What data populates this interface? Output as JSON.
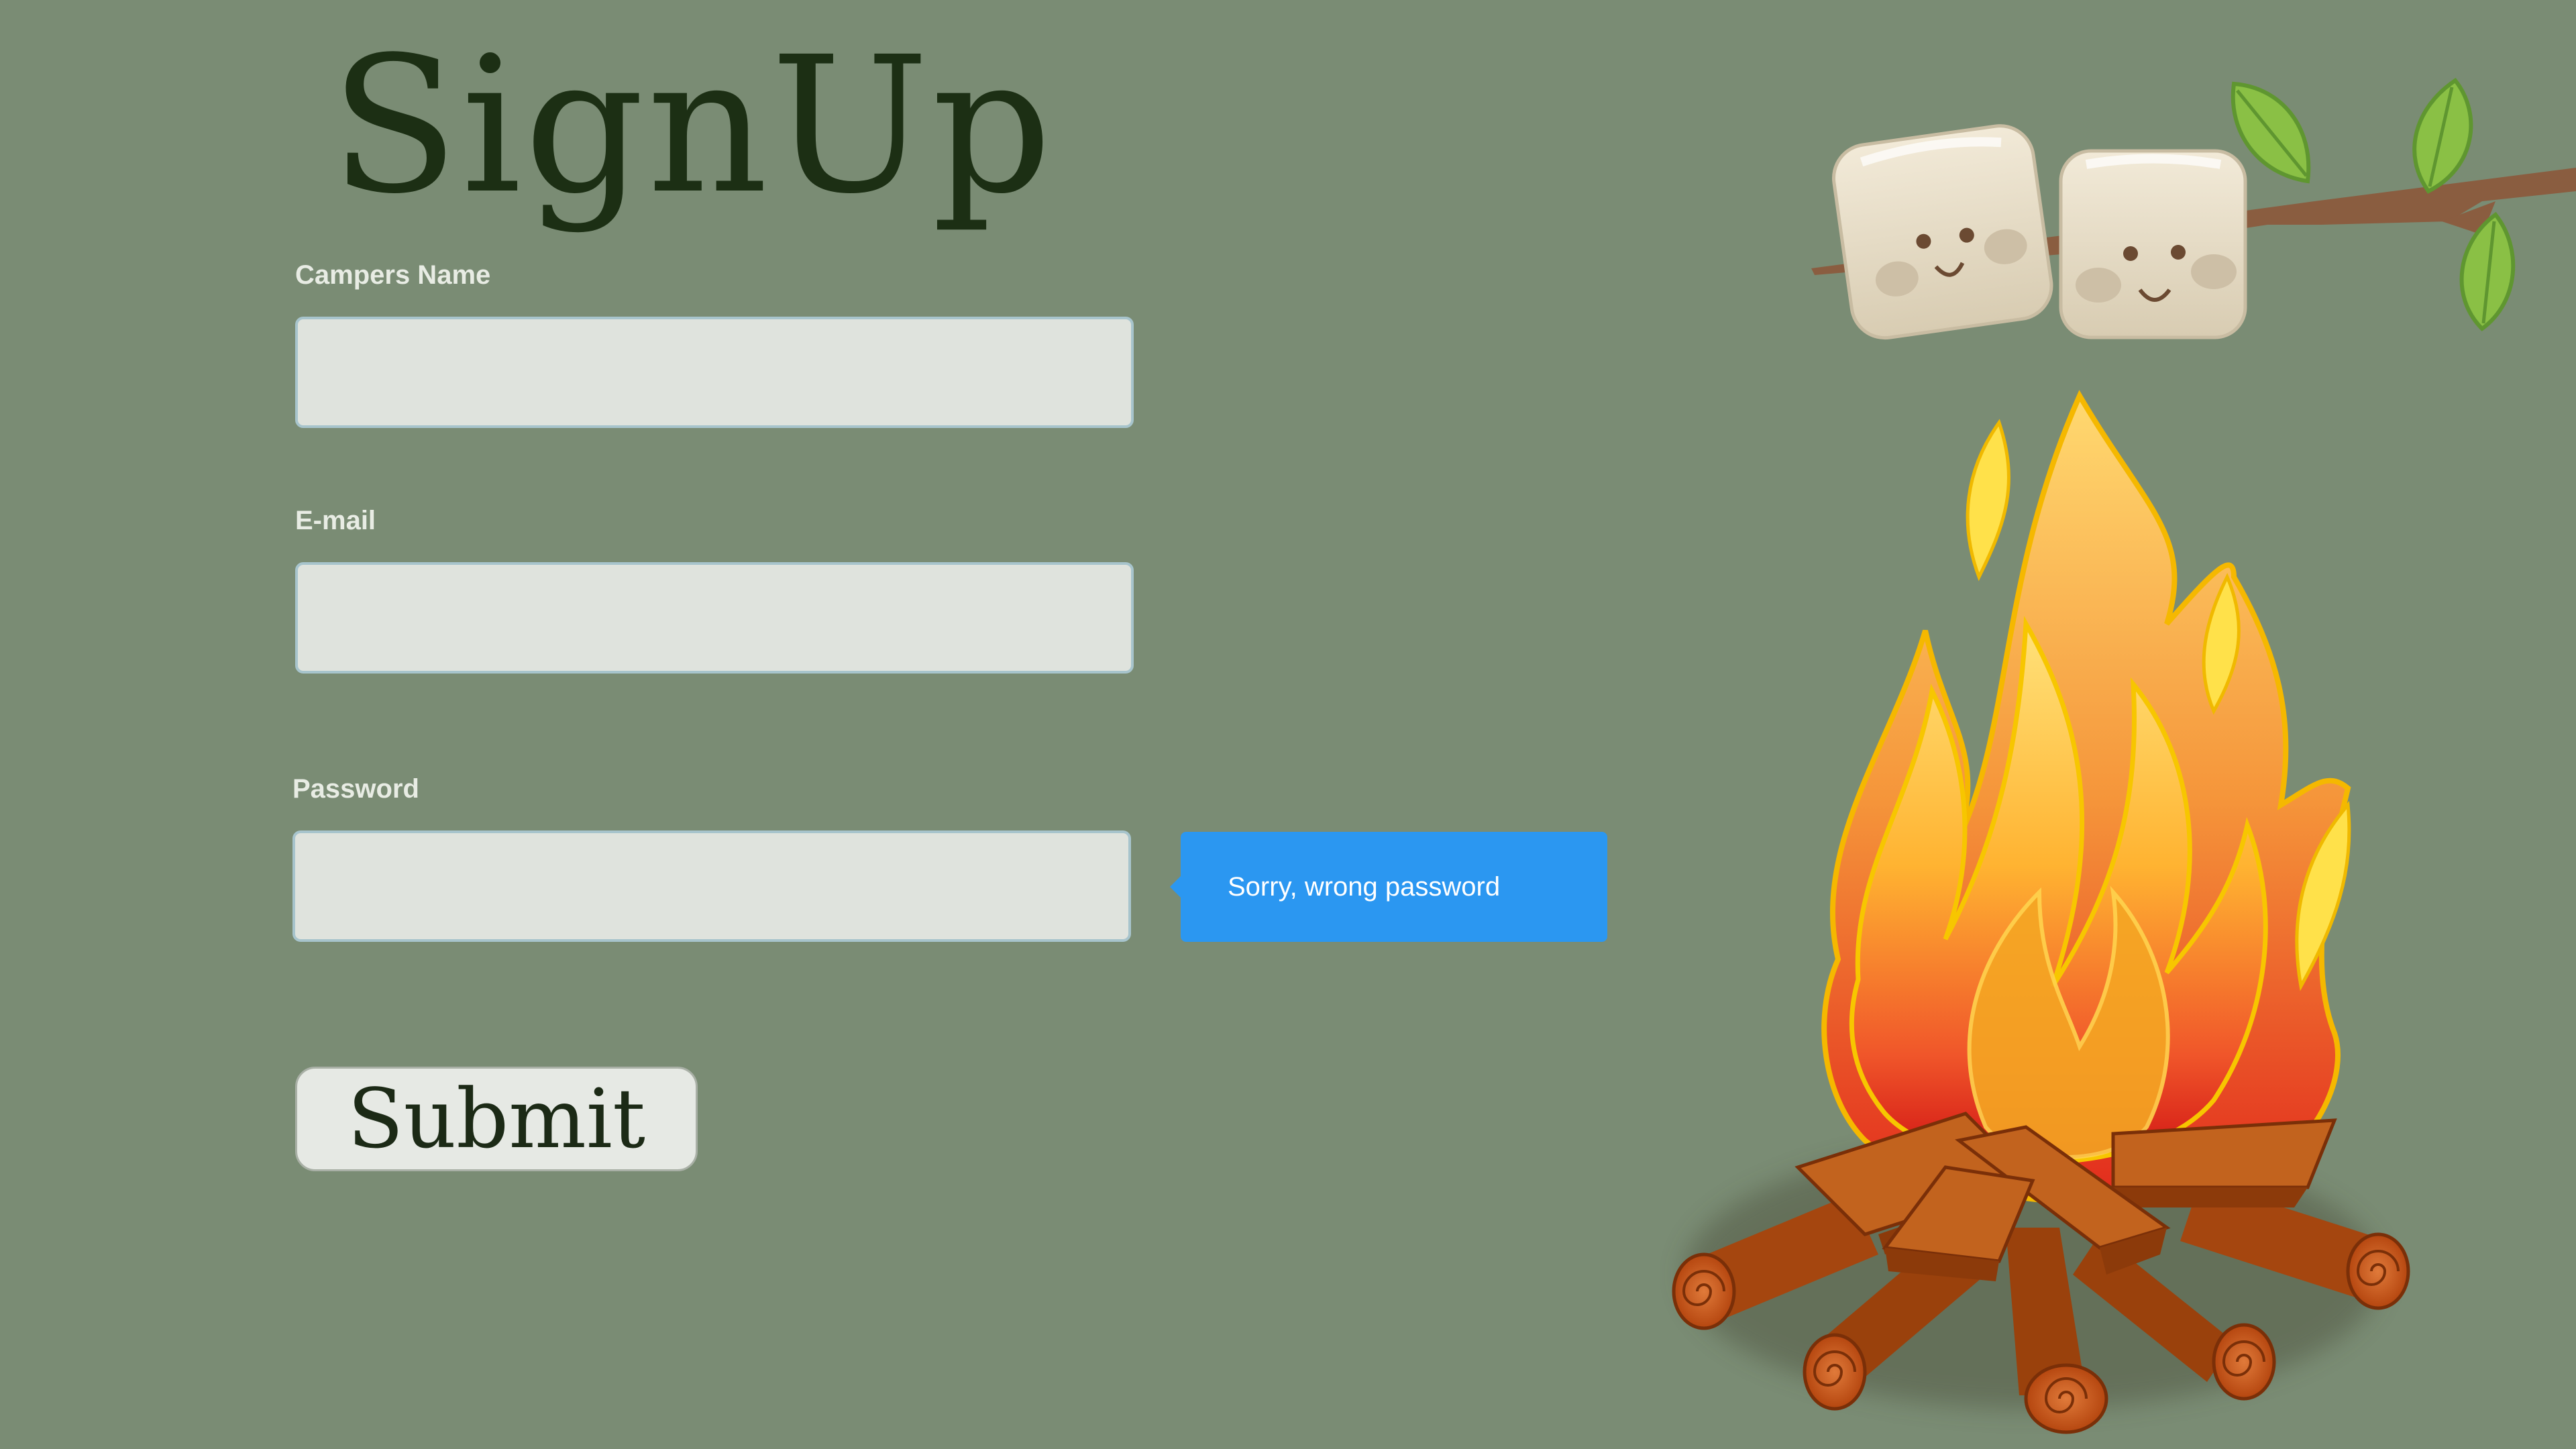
{
  "page": {
    "title": "SignUp"
  },
  "form": {
    "name_label": "Campers Name",
    "name_value": "",
    "email_label": "E-mail",
    "email_value": "",
    "password_label": "Password",
    "password_value": "",
    "error_message": "Sorry, wrong password",
    "submit_label": "Submit"
  },
  "colors": {
    "background": "#7a8c74",
    "title": "#1c2f14",
    "input_background": "#dfe3dd",
    "input_border": "#a7c4cc",
    "tooltip": "#2b97f1"
  },
  "illustration": {
    "description_icons": [
      "marshmallow-icon",
      "branch-icon",
      "leaf-icon",
      "flame-icon",
      "log-icon"
    ]
  }
}
